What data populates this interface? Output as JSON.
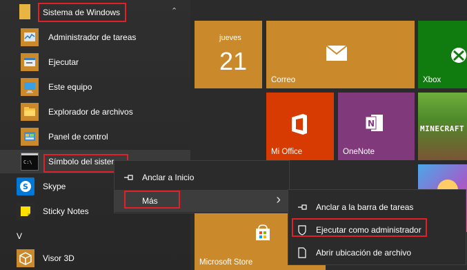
{
  "app_list": {
    "group_label": "Sistema de Windows",
    "items": [
      {
        "label": "Administrador de tareas",
        "icon": "task-manager-icon"
      },
      {
        "label": "Ejecutar",
        "icon": "run-icon"
      },
      {
        "label": "Este equipo",
        "icon": "this-pc-icon"
      },
      {
        "label": "Explorador de archivos",
        "icon": "file-explorer-icon"
      },
      {
        "label": "Panel de control",
        "icon": "control-panel-icon"
      },
      {
        "label": "Símbolo del sister",
        "icon": "command-prompt-icon"
      }
    ],
    "skype_label": "Skype",
    "sticky_label": "Sticky Notes",
    "section_v": "V",
    "visor_label": "Visor 3D"
  },
  "tiles": {
    "calendar_day_name": "jueves",
    "calendar_day_num": "21",
    "correo_label": "Correo",
    "xbox_label": "Xbox",
    "office_label": "Mi Office",
    "onenote_label": "OneNote",
    "minecraft_text": "MINECRAFT",
    "store_label": "Microsoft Store"
  },
  "context_menu": {
    "pin_start": "Anclar a Inicio",
    "more": "Más",
    "more_arrow": "›"
  },
  "submenu": {
    "pin_taskbar": "Anclar a la barra de tareas",
    "run_admin": "Ejecutar como administrador",
    "open_location": "Abrir ubicación de archivo"
  },
  "colors": {
    "accent_orange": "#ca8a2b",
    "office_red": "#d83b01",
    "onenote_purple": "#80397b",
    "xbox_green": "#107c10",
    "highlight_red": "#e2202a"
  }
}
